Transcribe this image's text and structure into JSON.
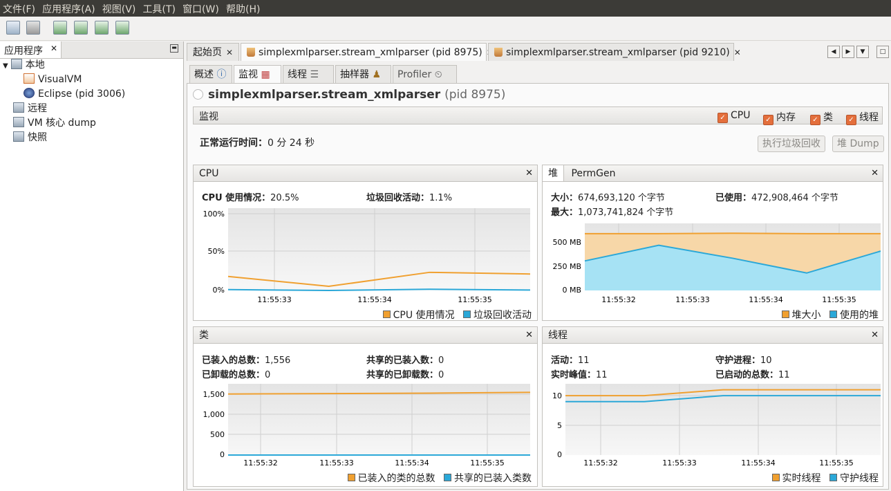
{
  "menu": [
    "文件(F)",
    "应用程序(A)",
    "视图(V)",
    "工具(T)",
    "窗口(W)",
    "帮助(H)"
  ],
  "left": {
    "tab_label": "应用程序",
    "tree": {
      "local": "本地",
      "visualvm": "VisualVM",
      "eclipse": "Eclipse (pid 3006)",
      "remote": "远程",
      "coredump": "VM 核心 dump",
      "snapshot": "快照"
    }
  },
  "doc_tabs": [
    "起始页",
    "simplexmlparser.stream_xmlparser (pid 8975)",
    "simplexmlparser.stream_xmlparser (pid 9210)"
  ],
  "sub_tabs": [
    "概述",
    "监视",
    "线程",
    "抽样器",
    "Profiler"
  ],
  "app": {
    "name": "simplexmlparser.stream_xmlparser",
    "pid": "(pid 8975)"
  },
  "monitor": {
    "title": "监视",
    "checks": [
      "CPU",
      "内存",
      "类",
      "线程"
    ],
    "uptime_label": "正常运行时间：",
    "uptime_value": "0 分 24 秒",
    "gc_button": "执行垃圾回收",
    "dump_button": "堆 Dump"
  },
  "cpu_panel": {
    "title": "CPU",
    "usage_label": "CPU 使用情况：",
    "usage_value": "20.5%",
    "gc_label": "垃圾回收活动：",
    "gc_value": "1.1%"
  },
  "heap_panel": {
    "tab_heap": "堆",
    "tab_permgen": "PermGen",
    "size_label": "大小：",
    "size_value": "674,693,120 个字节",
    "used_label": "已使用：",
    "used_value": "472,908,464 个字节",
    "max_label": "最大：",
    "max_value": "1,073,741,824 个字节"
  },
  "classes_panel": {
    "title": "类",
    "loaded_label": "已装入的总数：",
    "loaded_value": "1,556",
    "shared_loaded_label": "共享的已装入数：",
    "shared_loaded_value": "0",
    "unloaded_label": "已卸载的总数：",
    "unloaded_value": "0",
    "shared_unloaded_label": "共享的已卸载数：",
    "shared_unloaded_value": "0"
  },
  "threads_panel": {
    "title": "线程",
    "live_label": "活动：",
    "live_value": "11",
    "daemon_label": "守护进程：",
    "daemon_value": "10",
    "peak_label": "实时峰值：",
    "peak_value": "11",
    "started_label": "已启动的总数：",
    "started_value": "11"
  },
  "colors": {
    "orange": "#f0a030",
    "blue": "#2ba8d8",
    "orange_fill": "#f7d7a8",
    "blue_fill": "#a6e2f4"
  },
  "chart_data": [
    {
      "id": "cpu",
      "type": "line",
      "x": [
        "11:55:32.6",
        "11:55:33.7",
        "11:55:34.6",
        "11:55:35.6"
      ],
      "xticks": [
        "11:55:33",
        "11:55:34",
        "11:55:35"
      ],
      "yticks": [
        "0%",
        "50%",
        "100%"
      ],
      "ylim": [
        0,
        100
      ],
      "series": [
        {
          "name": "CPU 使用情况",
          "values": [
            17,
            5,
            22,
            20
          ]
        },
        {
          "name": "垃圾回收活动",
          "values": [
            1,
            0,
            1.5,
            0.5
          ]
        }
      ]
    },
    {
      "id": "heap",
      "type": "area",
      "x": [
        "11:55:32",
        "11:55:32.5",
        "11:55:33.5",
        "11:55:34.6",
        "11:55:35.5"
      ],
      "xticks": [
        "11:55:32",
        "11:55:33",
        "11:55:34",
        "11:55:35"
      ],
      "yticks": [
        "0 MB",
        "250 MB",
        "500 MB"
      ],
      "ylim": [
        0,
        750
      ],
      "series": [
        {
          "name": "堆大小",
          "values": [
            635,
            635,
            640,
            635,
            635
          ]
        },
        {
          "name": "使用的堆",
          "values": [
            330,
            505,
            360,
            195,
            440
          ]
        }
      ]
    },
    {
      "id": "classes",
      "type": "line",
      "xticks": [
        "11:55:32",
        "11:55:33",
        "11:55:34",
        "11:55:35"
      ],
      "yticks": [
        "0",
        "500",
        "1,000",
        "1,500"
      ],
      "ylim": [
        0,
        1750
      ],
      "series": [
        {
          "name": "已装入的类的总数",
          "values": [
            1500,
            1510,
            1520,
            1540
          ]
        },
        {
          "name": "共享的已装入类数",
          "values": [
            0,
            0,
            0,
            0
          ]
        }
      ]
    },
    {
      "id": "threads",
      "type": "line",
      "xticks": [
        "11:55:32",
        "11:55:33",
        "11:55:34",
        "11:55:35"
      ],
      "yticks": [
        "0",
        "5",
        "10"
      ],
      "ylim": [
        0,
        12
      ],
      "series": [
        {
          "name": "实时线程",
          "values": [
            10,
            10,
            11,
            11,
            11
          ]
        },
        {
          "name": "守护线程",
          "values": [
            9,
            9,
            10,
            10,
            10
          ]
        }
      ]
    }
  ]
}
